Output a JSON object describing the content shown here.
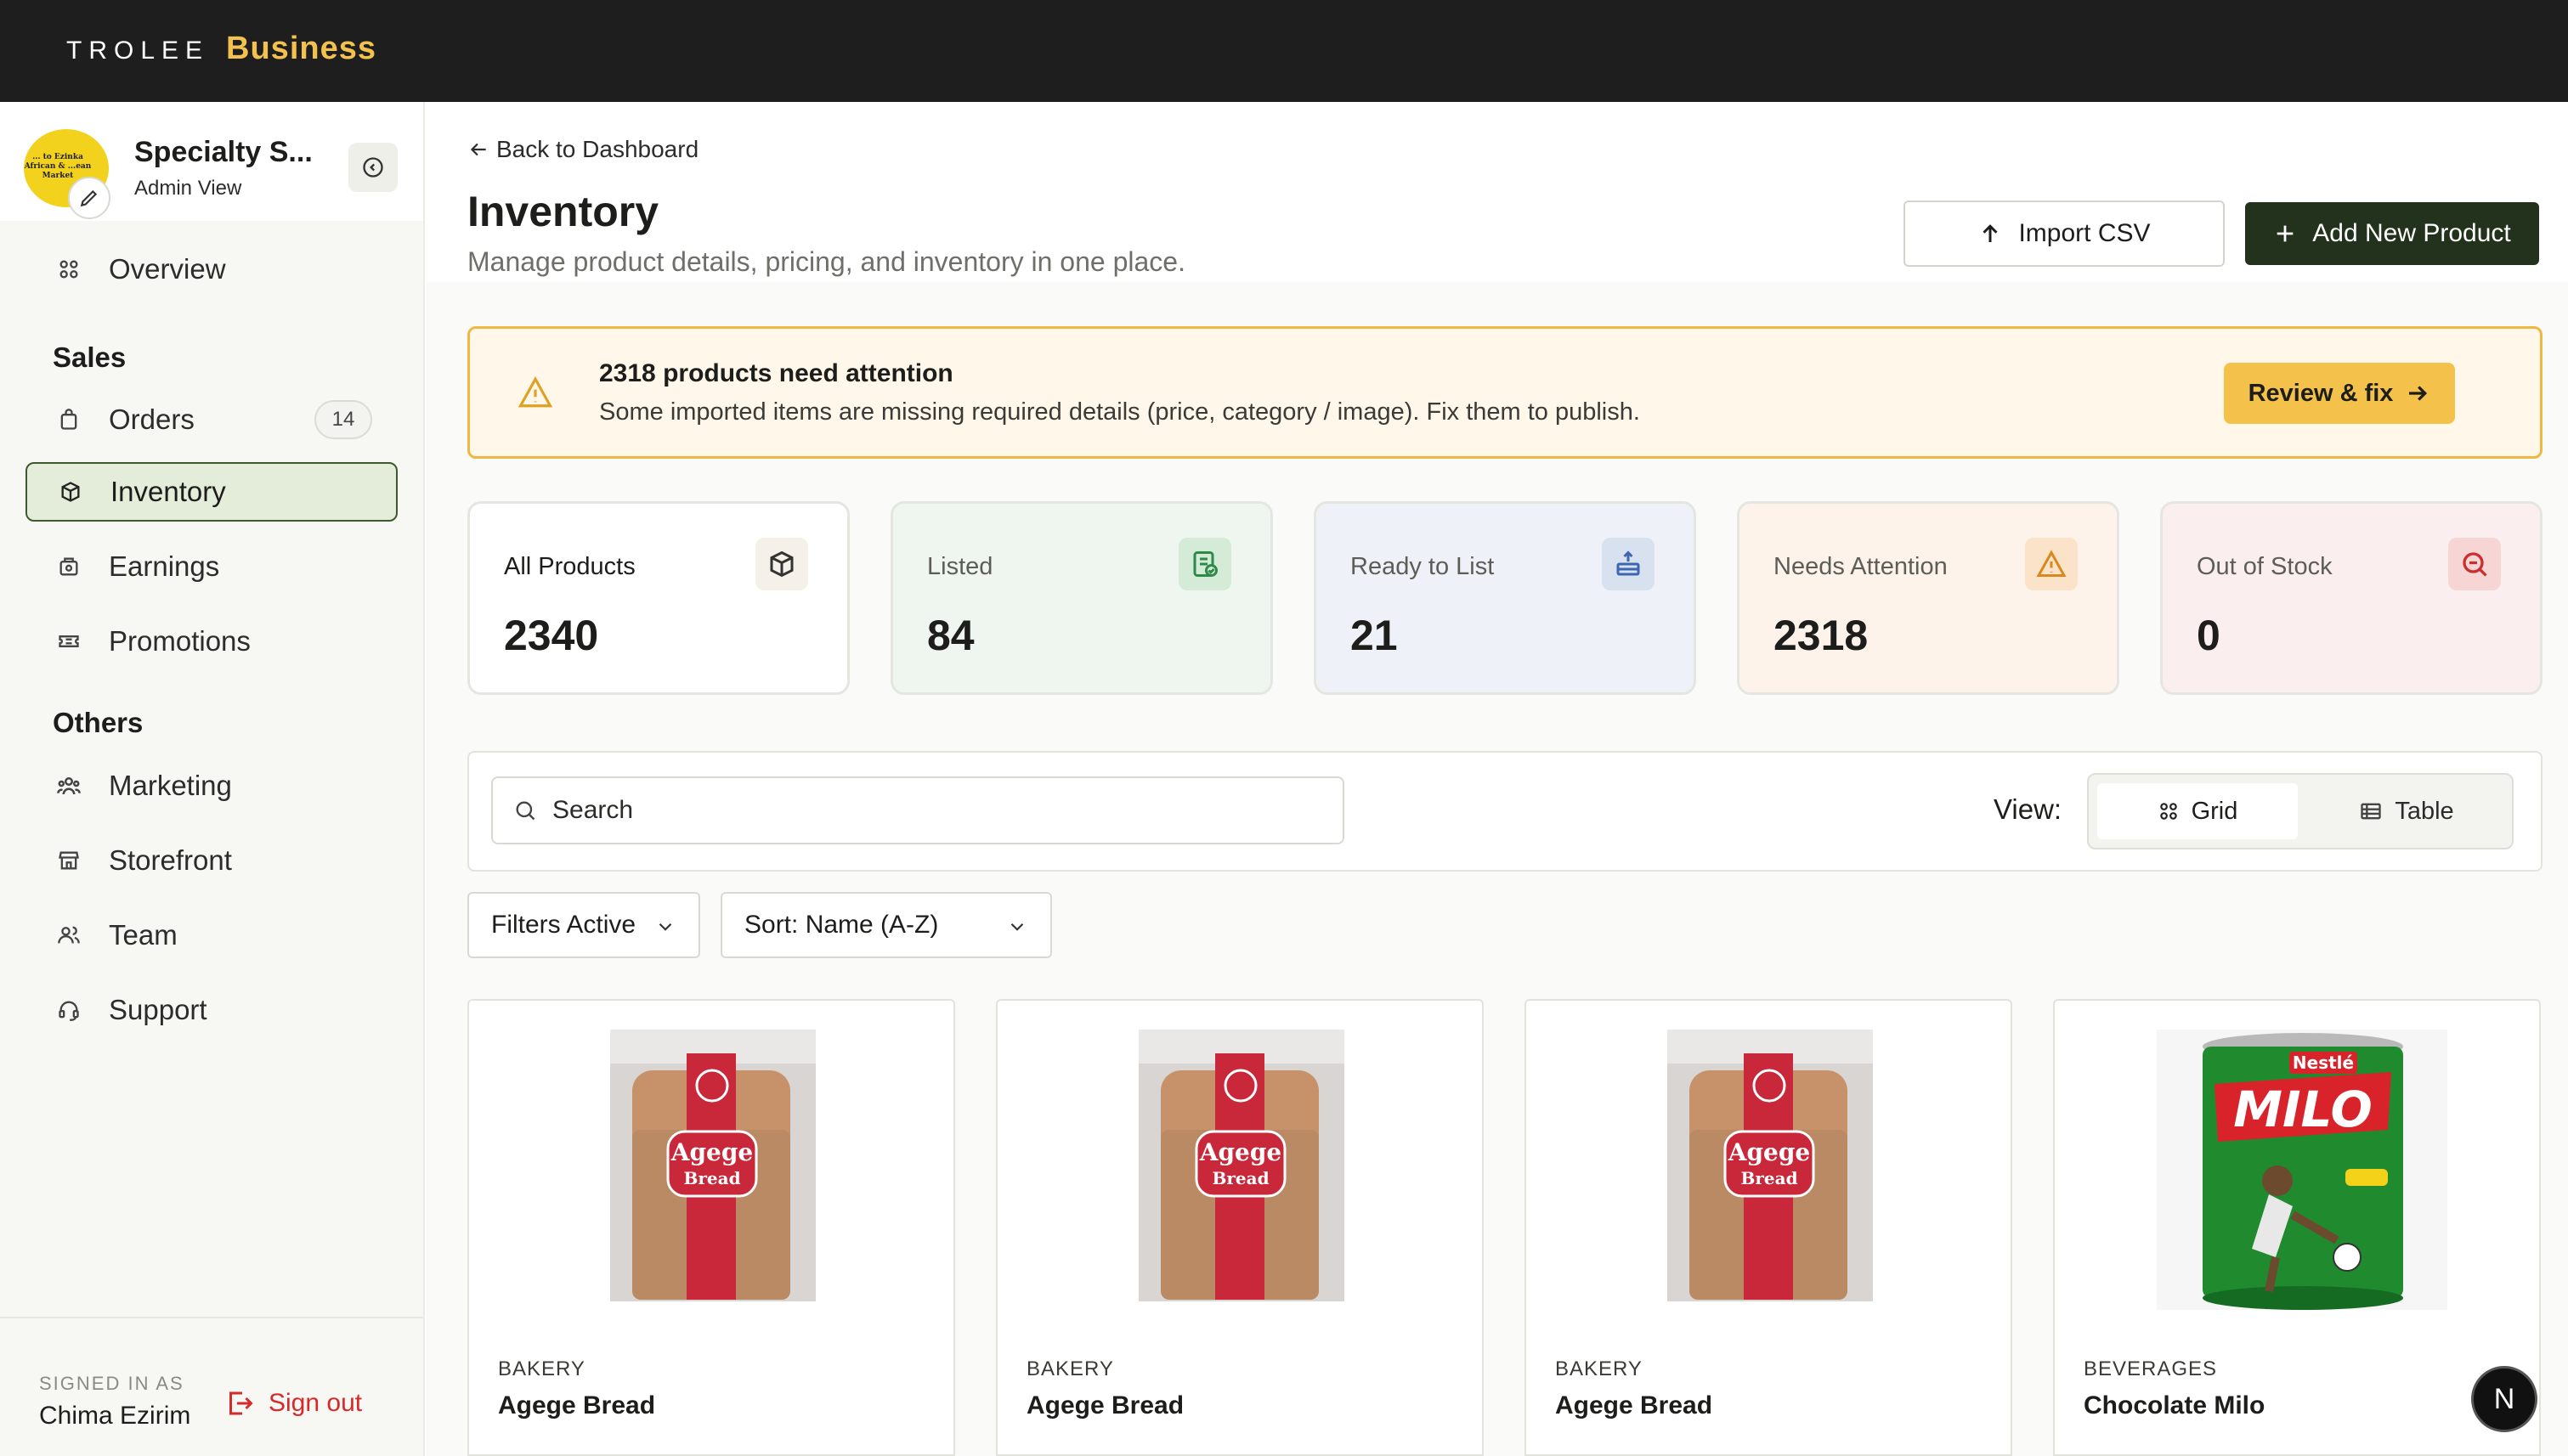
{
  "brand": {
    "name": "TROLEE",
    "sub": "Business"
  },
  "store": {
    "name": "Specialty S...",
    "role": "Admin View",
    "avatar_text": "... to Ezinka African & ...ean Market"
  },
  "nav": {
    "overview": "Overview",
    "sales_header": "Sales",
    "orders": "Orders",
    "orders_count": "14",
    "inventory": "Inventory",
    "earnings": "Earnings",
    "promotions": "Promotions",
    "others_header": "Others",
    "marketing": "Marketing",
    "storefront": "Storefront",
    "team": "Team",
    "support": "Support"
  },
  "user": {
    "signed_label": "SIGNED IN AS",
    "name": "Chima Ezirim",
    "signout": "Sign out"
  },
  "header": {
    "back": "Back to Dashboard",
    "title": "Inventory",
    "description": "Manage product details, pricing, and inventory in one place.",
    "import_label": "Import CSV",
    "add_label": "Add New Product"
  },
  "alert": {
    "title": "2318 products need attention",
    "text": "Some imported items are missing required details (price, category / image). Fix them to publish.",
    "button": "Review & fix"
  },
  "stats": [
    {
      "label": "All Products",
      "value": "2340"
    },
    {
      "label": "Listed",
      "value": "84"
    },
    {
      "label": "Ready to List",
      "value": "21"
    },
    {
      "label": "Needs Attention",
      "value": "2318"
    },
    {
      "label": "Out of Stock",
      "value": "0"
    }
  ],
  "toolbar": {
    "search_placeholder": "Search",
    "view_label": "View:",
    "grid_label": "Grid",
    "table_label": "Table",
    "filters_label": "Filters Active",
    "sort_label": "Sort: Name (A-Z)"
  },
  "products": [
    {
      "category": "BAKERY",
      "name": "Agege Bread",
      "brand_text": "Agege",
      "sub_text": "Bread"
    },
    {
      "category": "BAKERY",
      "name": "Agege Bread",
      "brand_text": "Agege",
      "sub_text": "Bread"
    },
    {
      "category": "BAKERY",
      "name": "Agege Bread",
      "brand_text": "Agege",
      "sub_text": "Bread"
    },
    {
      "category": "BEVERAGES",
      "name": "Chocolate Milo",
      "brand_text": "MILO",
      "sub_text": "Nestlé"
    }
  ],
  "fab_letter": "N",
  "colors": {
    "accent": "#23321c",
    "brand": "#f2c14e",
    "alert_border": "#f0b843",
    "danger": "#d62a2a"
  }
}
